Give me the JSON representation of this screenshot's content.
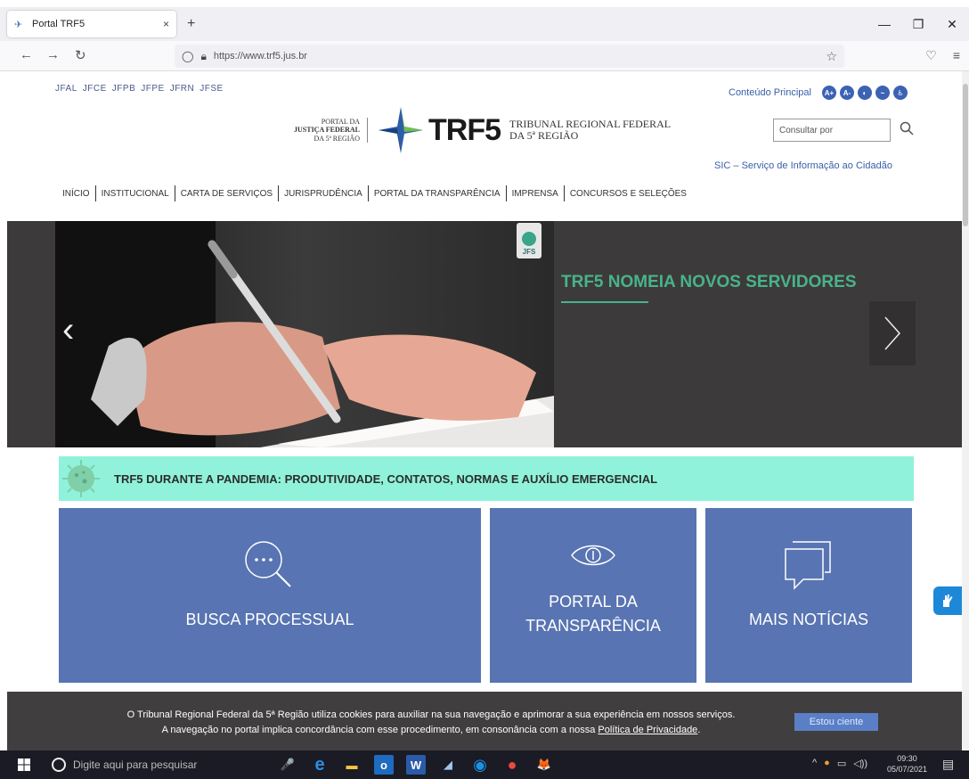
{
  "browser": {
    "tab_title": "Portal TRF5",
    "tab_close": "×",
    "new_tab": "+",
    "url": "https://www.trf5.jus.br",
    "win_min": "—",
    "win_restore": "❐",
    "win_close": "✕"
  },
  "header": {
    "sections": [
      "JFAL",
      "JFCE",
      "JFPB",
      "JFPE",
      "JFRN",
      "JFSE"
    ],
    "accessibility_label": "Conteúdo Principal",
    "accessibility_buttons": [
      "A+",
      "A-",
      "◐",
      "~",
      "♿"
    ],
    "portal_line1": "PORTAL DA",
    "portal_line2": "JUSTIÇA FEDERAL",
    "portal_line3": "DA 5ª REGIÃO",
    "logo_text": "TRF5",
    "tribunal_line1": "TRIBUNAL REGIONAL FEDERAL",
    "tribunal_line2": "DA 5ª REGIÃO",
    "search_placeholder": "Consultar por",
    "sic_link": "SIC – Serviço de Informação ao Cidadão"
  },
  "menu": [
    "INÍCIO",
    "INSTITUCIONAL",
    "CARTA DE SERVIÇOS",
    "JURISPRUDÊNCIA",
    "PORTAL DA TRANSPARÊNCIA",
    "IMPRENSA",
    "CONCURSOS E SELEÇÕES"
  ],
  "carousel": {
    "badge": "JFS",
    "headline": "TRF5 NOMEIA NOVOS SERVIDORES",
    "prev": "‹"
  },
  "pandemic_banner": "TRF5 DURANTE A PANDEMIA: PRODUTIVIDADE, CONTATOS, NORMAS E AUXÍLIO EMERGENCIAL",
  "cards": {
    "busca": "BUSCA PROCESSUAL",
    "portal_line1": "PORTAL DA",
    "portal_line2": "TRANSPARÊNCIA",
    "noticias": "MAIS NOTÍCIAS"
  },
  "cookie": {
    "line1": "O Tribunal Regional Federal da 5ª Região utiliza cookies para auxiliar na sua navegação e aprimorar a sua experiência em nossos serviços.",
    "line2_prefix": "A navegação no portal implica concordância com esse procedimento, em consonância com a nossa ",
    "line2_link": "Política de Privacidade",
    "line2_suffix": ".",
    "button": "Estou ciente"
  },
  "taskbar": {
    "search_placeholder": "Digite aqui para pesquisar",
    "time": "09:30",
    "date": "05/07/2021",
    "apps": [
      "🎤",
      "e",
      "▬",
      "o",
      "W",
      "◢",
      "◉",
      "●",
      "🦊"
    ]
  },
  "colors": {
    "card_blue": "#5874b2",
    "banner_green": "#90f2da",
    "headline_green": "#47b48a",
    "link_blue": "#3a5ea8"
  }
}
